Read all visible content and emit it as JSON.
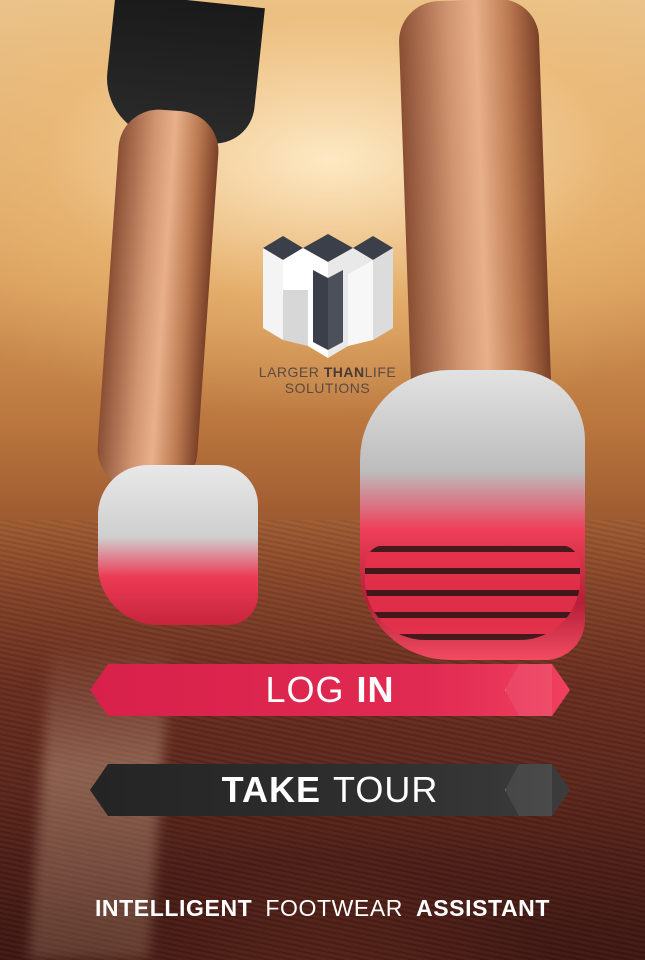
{
  "logo": {
    "caption_line1_a": "LARGER",
    "caption_line1_b": "THAN",
    "caption_line1_c": "LIFE",
    "caption_line2": "SOLUTIONS"
  },
  "buttons": {
    "login": {
      "label_light": "LOG",
      "label_strong": "IN"
    },
    "tour": {
      "label_strong": "TAKE",
      "label_light": "TOUR"
    }
  },
  "tagline": {
    "part1": "INTELLIGENT",
    "part2": "FOOTWEAR",
    "part3": "ASSISTANT"
  },
  "colors": {
    "login_button": "#e12a52",
    "tour_button": "#2a2a2a",
    "text": "#ffffff"
  },
  "icons": {
    "logo": "ltl-cube-logo-icon"
  }
}
